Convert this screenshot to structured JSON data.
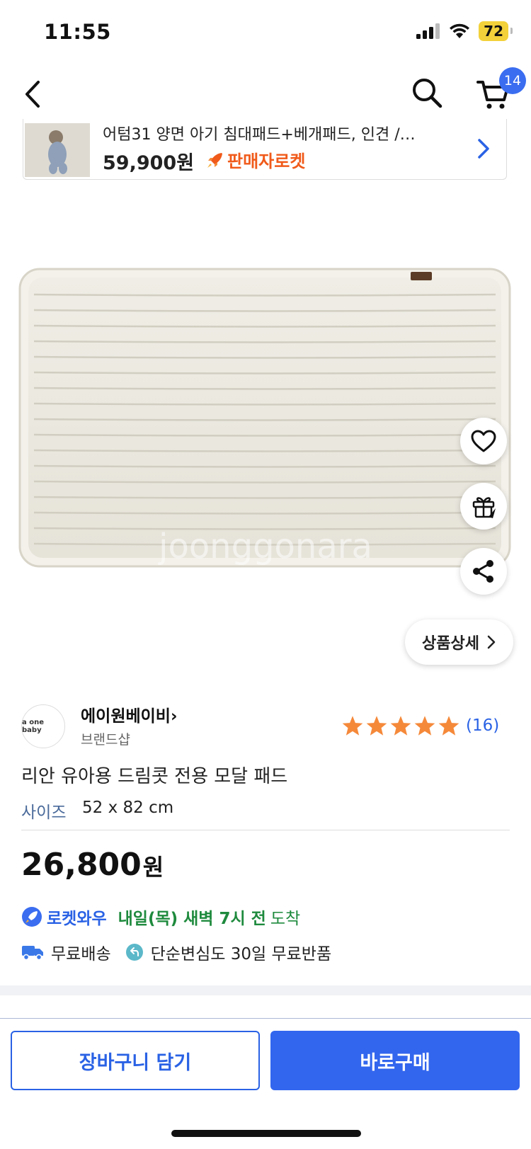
{
  "status_bar": {
    "time": "11:55",
    "battery": "72"
  },
  "header": {
    "cart_count": "14"
  },
  "related_product": {
    "title": "어텀31 양면 아기 침대패드+베개패드, 인견 /…",
    "price": "59,900원",
    "badge": "판매자로켓"
  },
  "image": {
    "watermark": "joonggonara",
    "tag": "brand"
  },
  "floating": {
    "detail_label": "상품상세"
  },
  "seller": {
    "logo_text": "a one baby",
    "name": "에이원베이비",
    "type": "브랜드샵",
    "rating_stars": 5,
    "review_count": "(16)"
  },
  "product": {
    "title": "리안 유아용 드림콧 전용 모달 패드",
    "size_label": "사이즈",
    "size_value": "52 x 82 cm",
    "price": "26,800",
    "price_unit": "원"
  },
  "delivery": {
    "service": "로켓와우",
    "date": "내일(목) 새벽 7시 전",
    "arrive": "도착",
    "shipping": "무료배송",
    "returns": "단순변심도 30일 무료반품"
  },
  "actions": {
    "add_to_cart": "장바구니 담기",
    "buy_now": "바로구매"
  },
  "colors": {
    "accent": "#3266ee",
    "rocket_orange": "#f05a1a",
    "green": "#1e8a3d",
    "star": "#f5893a"
  }
}
